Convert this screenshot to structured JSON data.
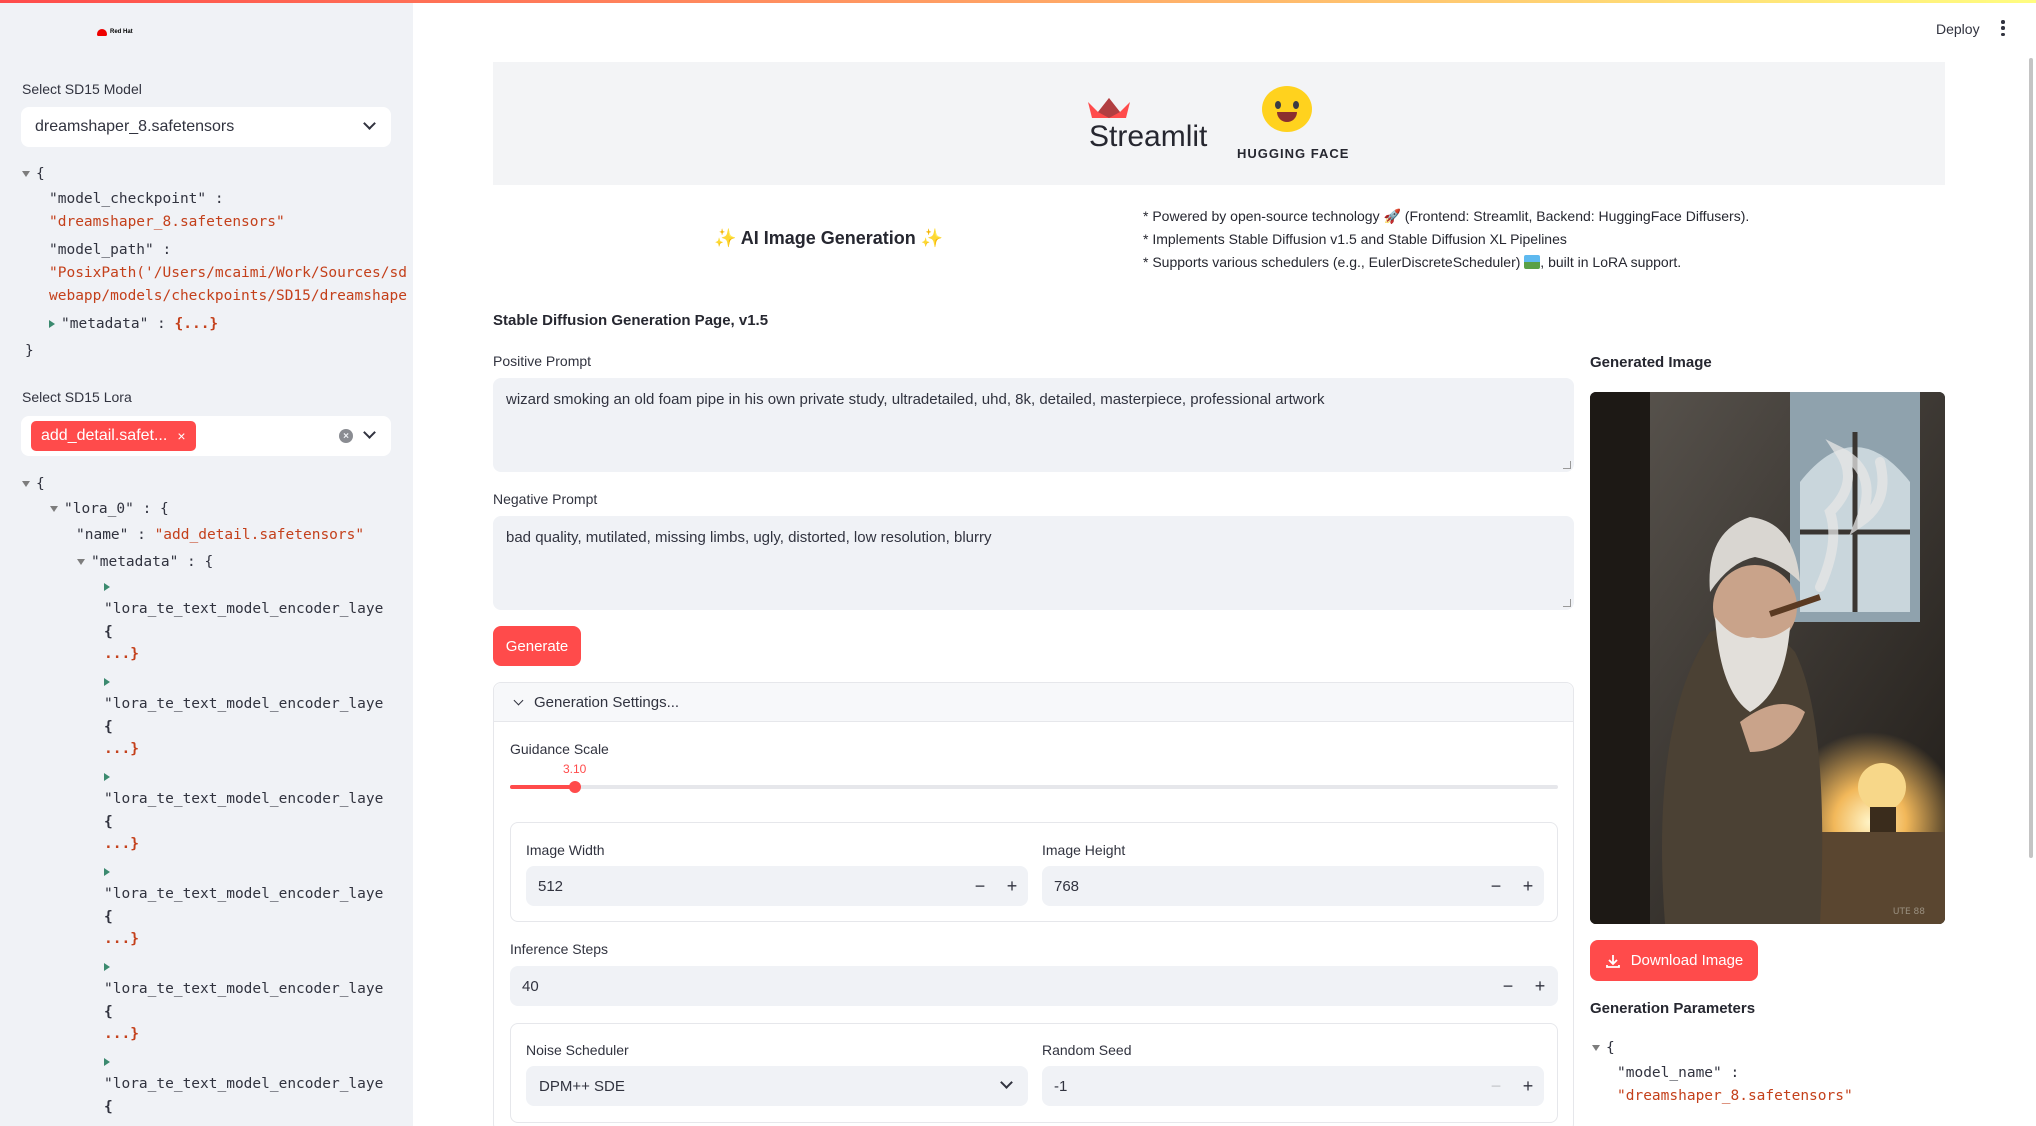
{
  "sidebar": {
    "logo_text": "Red Hat",
    "model_label": "Select SD15 Model",
    "model_value": "dreamshaper_8.safetensors",
    "model_json": {
      "open": "{",
      "checkpoint_key": "\"model_checkpoint\" :",
      "checkpoint_val": "\"dreamshaper_8.safetensors\"",
      "path_key": "\"model_path\" :",
      "path_val_1": "\"PosixPath('/Users/mcaimi/Work/Sources/sd",
      "path_val_2": "webapp/models/checkpoints/SD15/dreamshape",
      "metadata_key": "\"metadata\" :",
      "collapsed": "{...}",
      "close": "}"
    },
    "lora_label": "Select SD15 Lora",
    "lora_tag": "add_detail.safet...",
    "lora_json": {
      "open": "{",
      "lora0_key": "\"lora_0\" : {",
      "name_key": "\"name\" :",
      "name_val": "\"add_detail.safetensors\"",
      "metadata_key": "\"metadata\" : {",
      "entry_key": "\"lora_te_text_model_encoder_laye",
      "entry_open": "{",
      "entry_dots": "...}"
    }
  },
  "header": {
    "deploy_label": "Deploy"
  },
  "banner": {
    "streamlit_text": "Streamlit",
    "hf_text": "HUGGING FACE"
  },
  "intro": {
    "title": "✨ AI Image Generation ✨",
    "bullet_1": "* Powered by open-source technology 🚀 (Frontend: Streamlit, Backend: HuggingFace Diffusers).",
    "bullet_2": "* Implements Stable Diffusion v1.5 and Stable Diffusion XL Pipelines",
    "bullet_3a": "* Supports various schedulers (e.g., EulerDiscreteScheduler)",
    "bullet_3b": ", built in LoRA support."
  },
  "main": {
    "page_title": "Stable Diffusion Generation Page, v1.5",
    "positive_label": "Positive Prompt",
    "positive_value": "wizard smoking an old foam pipe in his own private study, ultradetailed, uhd, 8k, detailed, masterpiece, professional artwork",
    "negative_label": "Negative Prompt",
    "negative_value": "bad quality, mutilated, missing limbs, ugly, distorted, low resolution, blurry",
    "generate_label": "Generate",
    "settings": {
      "title": "Generation Settings...",
      "guidance_label": "Guidance Scale",
      "guidance_value": "3.10",
      "guidance_fraction": 0.062,
      "width_label": "Image Width",
      "width_value": "512",
      "height_label": "Image Height",
      "height_value": "768",
      "steps_label": "Inference Steps",
      "steps_value": "40",
      "scheduler_label": "Noise Scheduler",
      "scheduler_value": "DPM++ SDE",
      "seed_label": "Random Seed",
      "seed_value": "-1",
      "minus": "−",
      "plus": "+"
    }
  },
  "right": {
    "generated_title": "Generated Image",
    "watermark": "UTE 88",
    "download_label": "Download Image",
    "params_title": "Generation Parameters",
    "params_open": "{",
    "params_key": "\"model_name\" :",
    "params_val": "\"dreamshaper_8.safetensors\""
  },
  "colors": {
    "accent": "#ff4b4b",
    "sidebar_bg": "#f0f2f6",
    "json_string": "#c4401b"
  }
}
